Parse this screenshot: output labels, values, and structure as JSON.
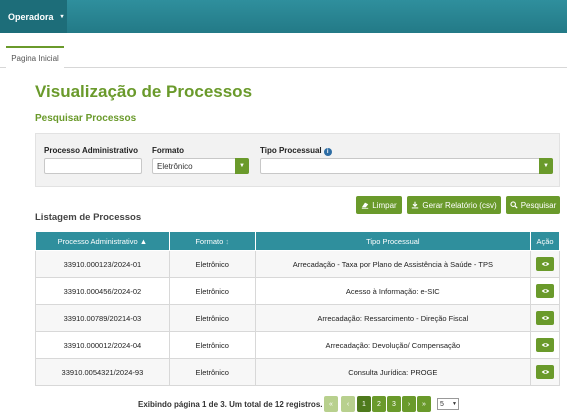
{
  "topbar": {
    "menu_label": "Operadora",
    "menu_caret": "▾"
  },
  "tabs": [
    {
      "label": "Pagina Inicial"
    }
  ],
  "page": {
    "title": "Visualização de Processos",
    "search_title": "Pesquisar Processos"
  },
  "filters": {
    "processo_label": "Processo Administrativo",
    "processo_value": "",
    "formato_label": "Formato",
    "formato_value": "Eletrônico",
    "tipo_label": "Tipo Processual",
    "tipo_value": ""
  },
  "buttons": {
    "limpar": "Limpar",
    "gerar": "Gerar Relatório (csv)",
    "pesquisar": "Pesquisar"
  },
  "list": {
    "title": "Listagem de Processos",
    "columns": [
      "Processo Administrativo",
      "Formato",
      "Tipo Processual",
      "Ação"
    ],
    "rows": [
      {
        "processo": "33910.000123/2024-01",
        "formato": "Eletrônico",
        "tipo": "Arrecadação - Taxa por Plano de Assistência à Saúde - TPS"
      },
      {
        "processo": "33910.000456/2024-02",
        "formato": "Eletrônico",
        "tipo": "Acesso à Informação: e-SIC"
      },
      {
        "processo": "33910.00789/20214-03",
        "formato": "Eletrônico",
        "tipo": "Arrecadação: Ressarcimento - Direção Fiscal"
      },
      {
        "processo": "33910.000012/2024-04",
        "formato": "Eletrônico",
        "tipo": "Arrecadação: Devolução/ Compensação"
      },
      {
        "processo": "33910.0054321/2024-93",
        "formato": "Eletrônico",
        "tipo": "Consulta Jurídica: PROGE"
      }
    ]
  },
  "pagination": {
    "summary": "Exibindo página 1 de 3. Um total de 12 registros.",
    "first": "«",
    "prev": "‹",
    "pages": [
      "1",
      "2",
      "3"
    ],
    "next": "›",
    "last": "»",
    "page_size": "5"
  },
  "colors": {
    "accent_green": "#6a9a2b",
    "header_teal": "#2f8f9d"
  },
  "icons": [
    "chevron-down-icon",
    "info-icon",
    "eraser-icon",
    "download-icon",
    "search-icon",
    "eye-icon",
    "sort-asc-icon",
    "sort-icon"
  ]
}
